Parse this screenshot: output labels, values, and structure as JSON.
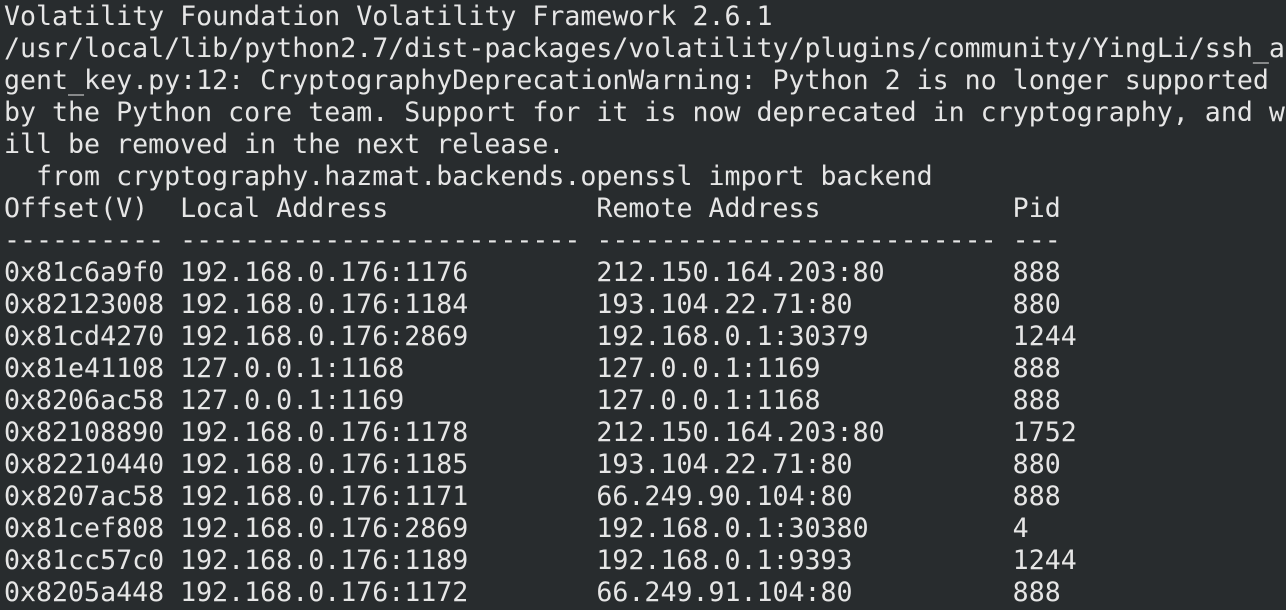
{
  "terminal": {
    "header_lines": [
      "Volatility Foundation Volatility Framework 2.6.1",
      "/usr/local/lib/python2.7/dist-packages/volatility/plugins/community/YingLi/ssh_a",
      "gent_key.py:12: CryptographyDeprecationWarning: Python 2 is no longer supported",
      "by the Python core team. Support for it is now deprecated in cryptography, and w",
      "ill be removed in the next release.",
      "  from cryptography.hazmat.backends.openssl import backend"
    ],
    "table": {
      "header": "Offset(V)  Local Address             Remote Address            Pid",
      "separator": "---------- ------------------------- ------------------------- ---",
      "rows": [
        "0x81c6a9f0 192.168.0.176:1176        212.150.164.203:80        888",
        "0x82123008 192.168.0.176:1184        193.104.22.71:80          880",
        "0x81cd4270 192.168.0.176:2869        192.168.0.1:30379         1244",
        "0x81e41108 127.0.0.1:1168            127.0.0.1:1169            888",
        "0x8206ac58 127.0.0.1:1169            127.0.0.1:1168            888",
        "0x82108890 192.168.0.176:1178        212.150.164.203:80        1752",
        "0x82210440 192.168.0.176:1185        193.104.22.71:80          880",
        "0x8207ac58 192.168.0.176:1171        66.249.90.104:80          888",
        "0x81cef808 192.168.0.176:2869        192.168.0.1:30380         4",
        "0x81cc57c0 192.168.0.176:1189        192.168.0.1:9393          1244",
        "0x8205a448 192.168.0.176:1172        66.249.91.104:80          888"
      ]
    }
  }
}
